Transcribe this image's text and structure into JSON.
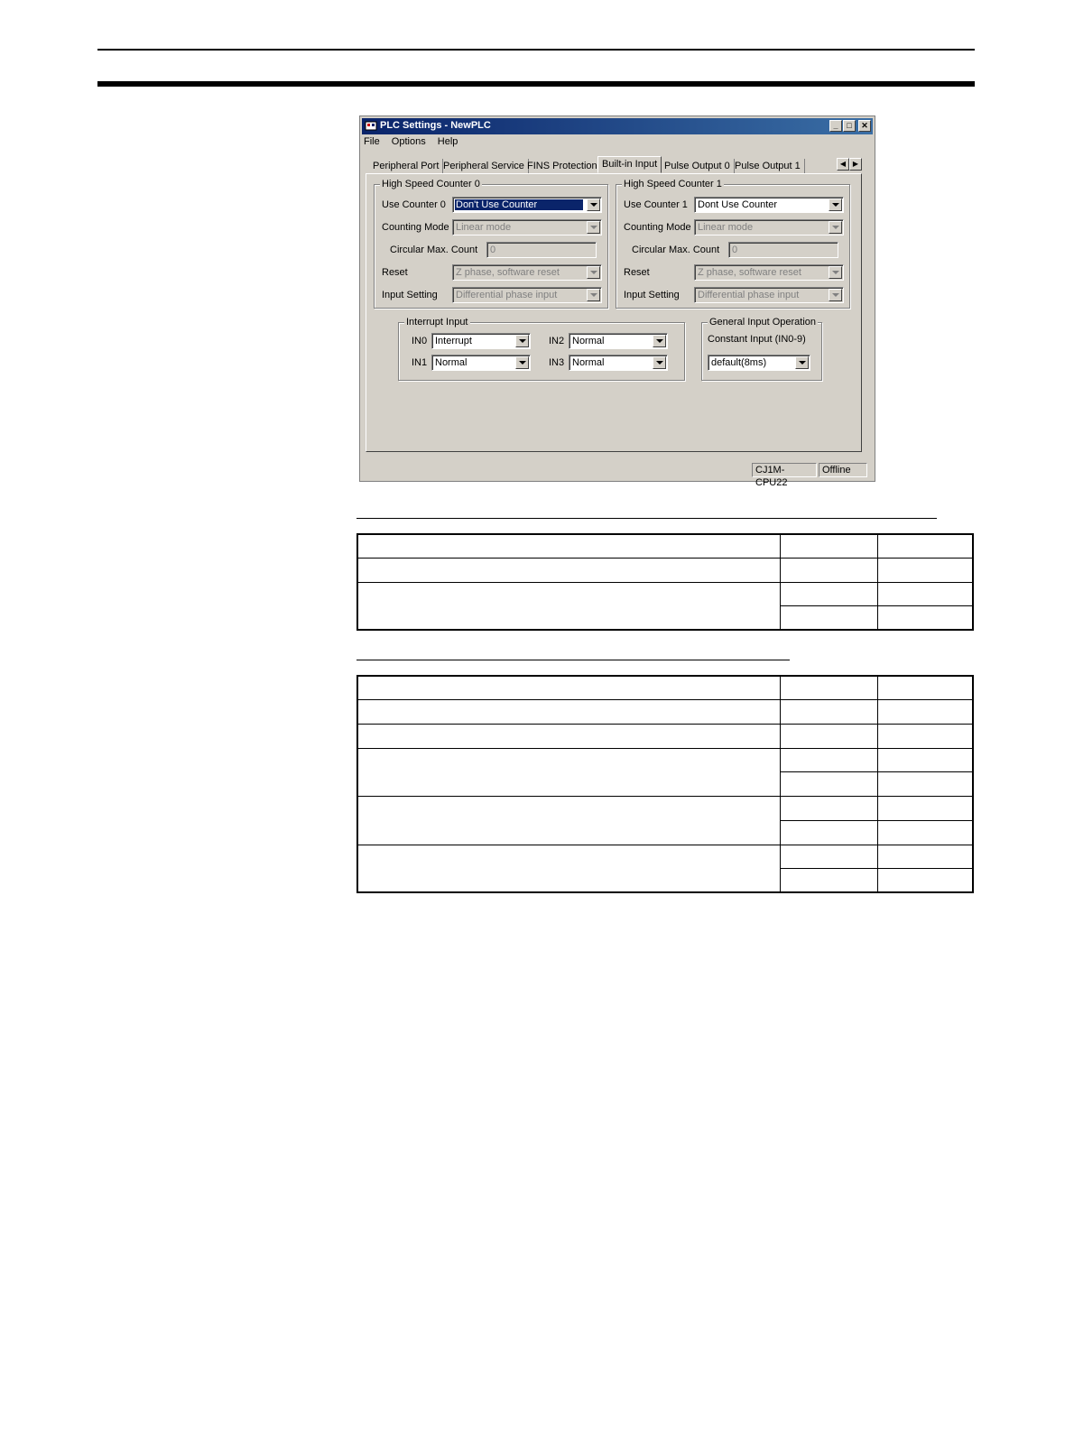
{
  "window": {
    "title": "PLC Settings - NewPLC",
    "menu": [
      "File",
      "Options",
      "Help"
    ],
    "tabs": [
      "Peripheral Port",
      "Peripheral Service",
      "FINS Protection",
      "Built-in Input",
      "Pulse Output 0",
      "Pulse Output 1"
    ],
    "active_tab": "Built-in Input",
    "hsc0": {
      "title": "High Speed Counter 0",
      "use_counter_label": "Use Counter 0",
      "use_counter_value": "Don't Use Counter",
      "counting_mode_label": "Counting Mode",
      "counting_mode_value": "Linear mode",
      "circular_label": "Circular Max. Count",
      "circular_value": "0",
      "reset_label": "Reset",
      "reset_value": "Z phase, software reset",
      "input_setting_label": "Input Setting",
      "input_setting_value": "Differential phase input"
    },
    "hsc1": {
      "title": "High Speed Counter 1",
      "use_counter_label": "Use Counter 1",
      "use_counter_value": "Dont Use Counter",
      "counting_mode_label": "Counting Mode",
      "counting_mode_value": "Linear mode",
      "circular_label": "Circular Max. Count",
      "circular_value": "0",
      "reset_label": "Reset",
      "reset_value": "Z phase, software reset",
      "input_setting_label": "Input Setting",
      "input_setting_value": "Differential phase input"
    },
    "interrupt": {
      "title": "Interrupt Input",
      "in0_label": "IN0",
      "in0_value": "Interrupt",
      "in1_label": "IN1",
      "in1_value": "Normal",
      "in2_label": "IN2",
      "in2_value": "Normal",
      "in3_label": "IN3",
      "in3_value": "Normal"
    },
    "general": {
      "title": "General Input Operation",
      "constant_label": "Constant Input (IN0-9)",
      "constant_value": "default(8ms)"
    },
    "status": {
      "model": "CJ1M-CPU22",
      "mode": "Offline"
    }
  }
}
